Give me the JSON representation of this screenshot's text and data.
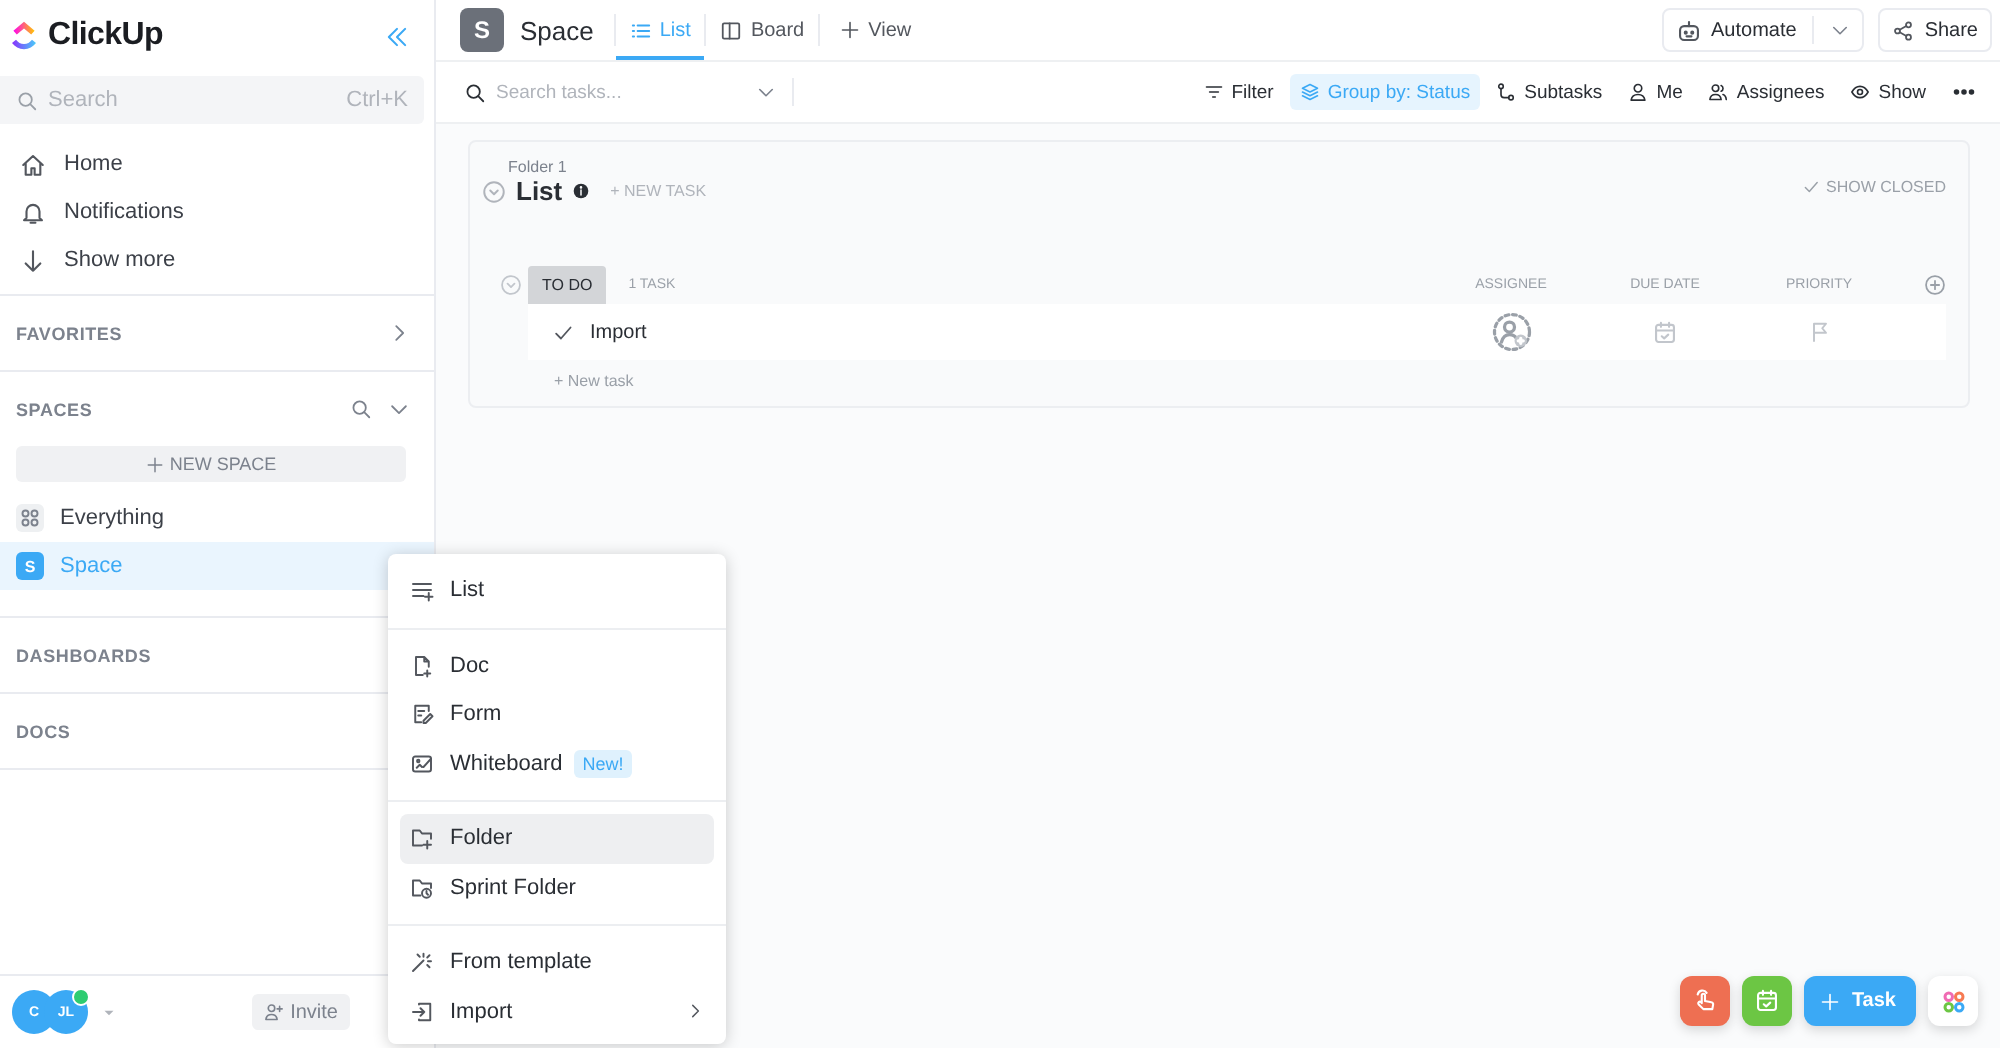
{
  "sidebar": {
    "logo": "ClickUp",
    "search": {
      "placeholder": "Search",
      "shortcut": "Ctrl+K"
    },
    "nav": [
      {
        "kind": "home",
        "label": "Home"
      },
      {
        "kind": "bell",
        "label": "Notifications"
      },
      {
        "kind": "down",
        "label": "Show more"
      }
    ],
    "favorites": {
      "title": "FAVORITES"
    },
    "spaces": {
      "title": "SPACES",
      "new_space": "NEW SPACE",
      "items": [
        {
          "kind": "everything",
          "label": "Everything",
          "selected": false
        },
        {
          "kind": "space",
          "avatar": "S",
          "label": "Space",
          "selected": true
        }
      ]
    },
    "dashboards": {
      "title": "DASHBOARDS"
    },
    "docs": {
      "title": "DOCS"
    },
    "footer": {
      "avatars": [
        "C",
        "JL"
      ],
      "online": true,
      "invite": "Invite"
    }
  },
  "header": {
    "avatar": "S",
    "title": "Space",
    "views": [
      {
        "kind": "list",
        "label": "List",
        "selected": true
      },
      {
        "kind": "board",
        "label": "Board",
        "selected": false
      }
    ],
    "add_view": "View",
    "automate": "Automate",
    "share": "Share"
  },
  "toolbar": {
    "search": {
      "placeholder": "Search tasks..."
    },
    "buttons": [
      {
        "kind": "filter",
        "label": "Filter",
        "selected": false
      },
      {
        "kind": "group",
        "label": "Group by: Status",
        "selected": true
      },
      {
        "kind": "subtasks",
        "label": "Subtasks",
        "selected": false
      },
      {
        "kind": "me",
        "label": "Me",
        "selected": false
      },
      {
        "kind": "assignees",
        "label": "Assignees",
        "selected": false
      },
      {
        "kind": "show",
        "label": "Show",
        "selected": false
      }
    ]
  },
  "list": {
    "folder": "Folder 1",
    "title": "List",
    "new_task": "+ NEW TASK",
    "show_closed": "SHOW CLOSED",
    "group": {
      "status": "TO DO",
      "count": "1 TASK",
      "columns": [
        "ASSIGNEE",
        "DUE DATE",
        "PRIORITY"
      ],
      "tasks": [
        {
          "name": "Import"
        }
      ],
      "new_task": "+ New task"
    }
  },
  "menu": {
    "sections": [
      [
        {
          "kind": "list",
          "label": "List",
          "highlighted": false
        }
      ],
      [
        {
          "kind": "doc",
          "label": "Doc",
          "highlighted": false
        },
        {
          "kind": "form",
          "label": "Form",
          "highlighted": false
        },
        {
          "kind": "whiteboard",
          "label": "Whiteboard",
          "badge": "New!",
          "highlighted": false
        }
      ],
      [
        {
          "kind": "folder",
          "label": "Folder",
          "highlighted": true
        },
        {
          "kind": "sprint",
          "label": "Sprint Folder",
          "highlighted": false
        }
      ],
      [
        {
          "kind": "template",
          "label": "From template",
          "highlighted": false
        },
        {
          "kind": "import",
          "label": "Import",
          "submenu": true,
          "highlighted": false
        }
      ]
    ]
  },
  "fabs": [
    {
      "kind": "hand",
      "color": "#ee6f52"
    },
    {
      "kind": "calendar",
      "color": "#6cc644"
    },
    {
      "kind": "task",
      "label": "Task",
      "color": "#3ba9f5"
    },
    {
      "kind": "apps",
      "color": "#ffffff"
    }
  ]
}
